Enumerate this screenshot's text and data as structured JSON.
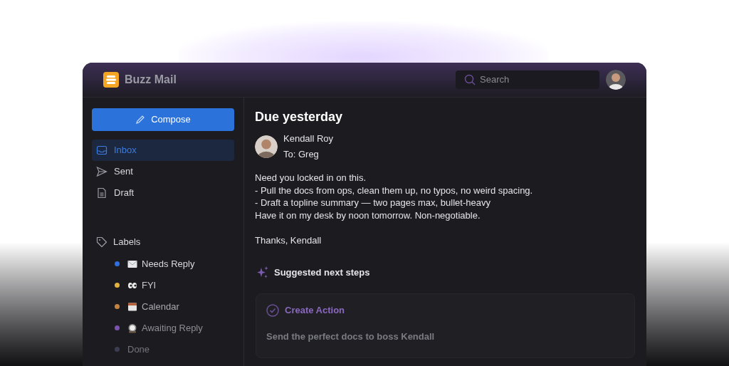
{
  "app": {
    "name": "Buzz Mail"
  },
  "search": {
    "placeholder": "Search"
  },
  "compose": {
    "label": "Compose"
  },
  "nav": [
    {
      "label": "Inbox",
      "selected": true
    },
    {
      "label": "Sent",
      "selected": false
    },
    {
      "label": "Draft",
      "selected": false
    }
  ],
  "labels": {
    "title": "Labels",
    "items": [
      {
        "label": "Needs Reply",
        "color": "#2f6fe0"
      },
      {
        "label": "FYI",
        "color": "#e2b23e"
      },
      {
        "label": "Calendar",
        "color": "#c4843f"
      },
      {
        "label": "Awaiting Reply",
        "color": "#7b52ad"
      },
      {
        "label": "Done",
        "color": "#3b3d52"
      }
    ]
  },
  "email": {
    "subject": "Due yesterday",
    "sender": "Kendall Roy",
    "to": "To: Greg",
    "body": [
      "Need you locked in on this.",
      "- Pull the docs from ops, clean them up, no typos, no weird spacing.",
      "- Draft a topline summary — two pages max, bullet-heavy",
      "Have it on my desk by noon tomorrow. Non-negotiable."
    ],
    "signoff": "Thanks, Kendall"
  },
  "suggestions": {
    "title": "Suggested next steps",
    "card": {
      "action": "Create Action",
      "task": "Send the perfect docs to boss Kendall"
    }
  }
}
